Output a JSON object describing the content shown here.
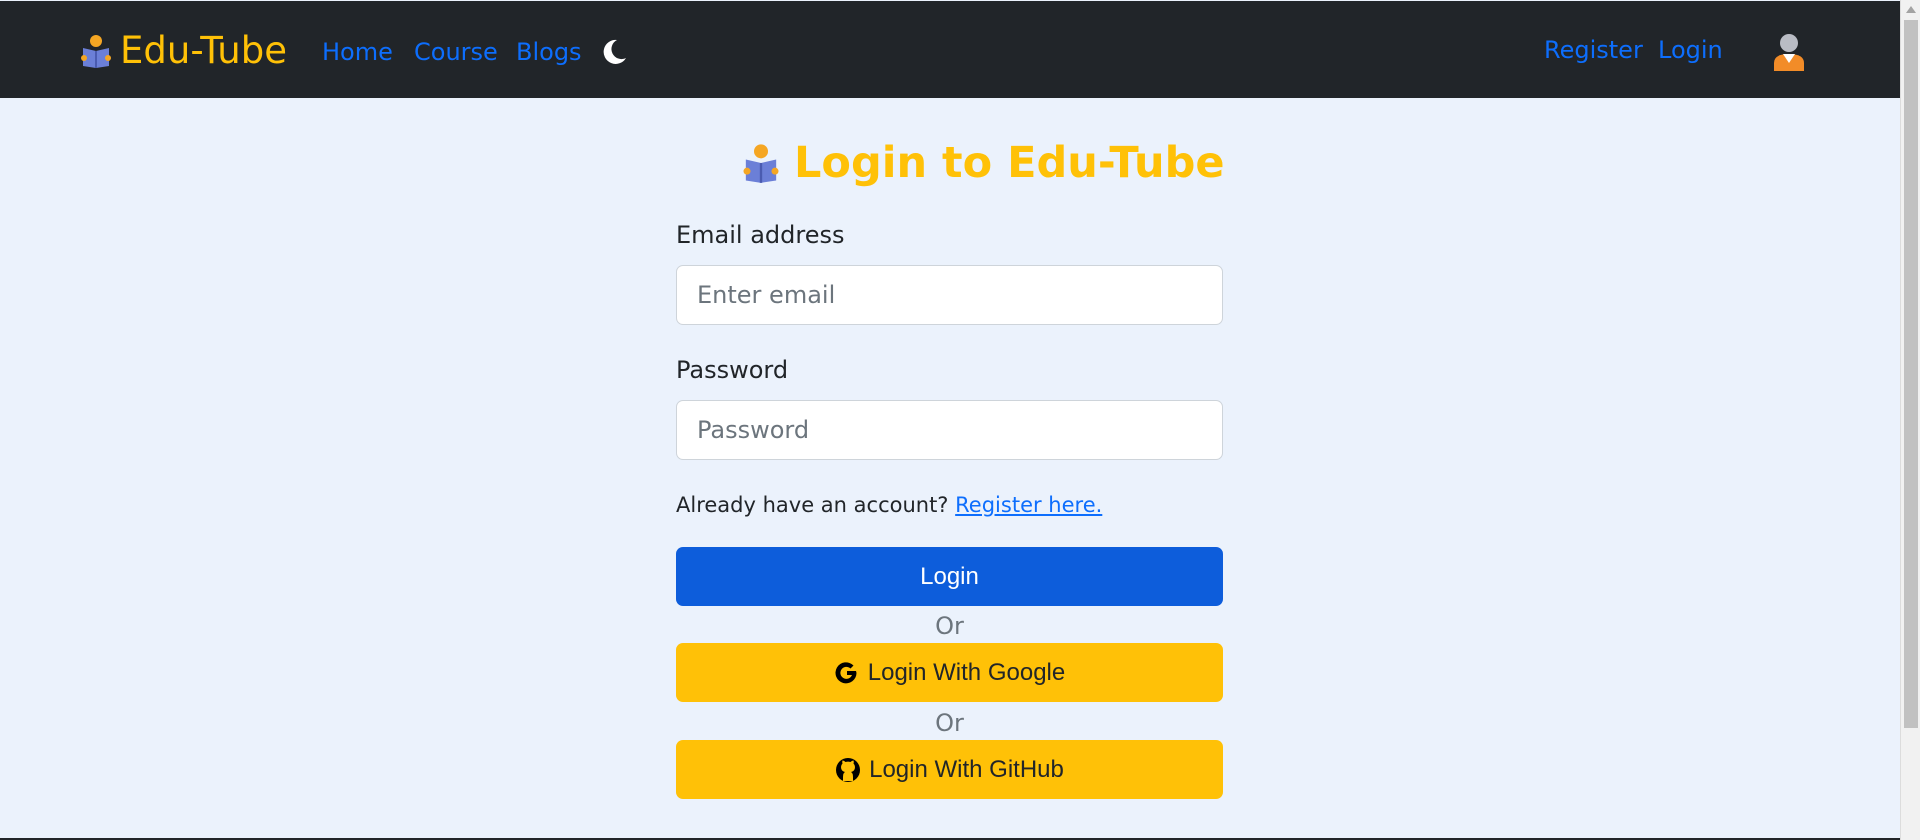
{
  "navbar": {
    "brand": "Edu-Tube",
    "links": [
      "Home",
      "Course",
      "Blogs"
    ],
    "right_links": [
      "Register",
      "Login"
    ],
    "theme_icon": "moon-icon",
    "avatar_icon": "user-avatar-icon"
  },
  "form": {
    "title": "Login to Edu-Tube",
    "email_label": "Email address",
    "email_placeholder": "Enter email",
    "password_label": "Password",
    "password_placeholder": "Password",
    "account_prompt": "Already have an account?",
    "register_link": "Register here.",
    "login_button": "Login",
    "or_text": "Or",
    "google_button": "Login With Google",
    "github_button": "Login With GitHub"
  },
  "colors": {
    "navbar_bg": "#212529",
    "brand": "#ffc107",
    "link": "#0d6efd",
    "page_bg": "#ebf2fc",
    "primary_button": "#0d5ddb",
    "warning_button": "#ffc107"
  }
}
